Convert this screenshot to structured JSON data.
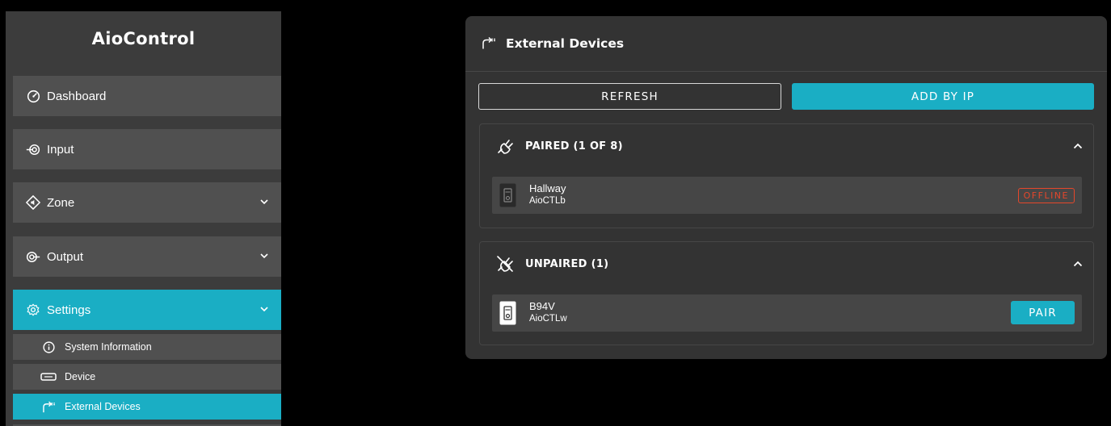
{
  "app": {
    "brand": "AioControl"
  },
  "sidebar": {
    "items": [
      {
        "label": "Dashboard",
        "icon": "gauge-icon",
        "has_chevron": false,
        "active": false
      },
      {
        "label": "Input",
        "icon": "input-icon",
        "has_chevron": false,
        "active": false
      },
      {
        "label": "Zone",
        "icon": "speaker-icon",
        "has_chevron": true,
        "active": false
      },
      {
        "label": "Output",
        "icon": "output-icon",
        "has_chevron": true,
        "active": false
      },
      {
        "label": "Settings",
        "icon": "gear-icon",
        "has_chevron": true,
        "active": true
      }
    ],
    "sub_items": [
      {
        "label": "System Information",
        "icon": "info-icon",
        "active": false
      },
      {
        "label": "Device",
        "icon": "device-icon",
        "active": false
      },
      {
        "label": "External Devices",
        "icon": "external-devices-icon",
        "active": true
      }
    ]
  },
  "panel": {
    "title": "External Devices",
    "icon": "external-devices-icon",
    "refresh_label": "REFRESH",
    "add_by_ip_label": "ADD BY IP",
    "paired": {
      "title": "PAIRED (1 OF 8)",
      "icon": "plug-icon",
      "devices": [
        {
          "name": "Hallway",
          "model": "AioCTLb",
          "status": "OFFLINE",
          "icon": "keypad-dark-icon"
        }
      ]
    },
    "unpaired": {
      "title": "UNPAIRED (1)",
      "icon": "plug-disconnected-icon",
      "devices": [
        {
          "name": "B94V",
          "model": "AioCTLw",
          "action": "PAIR",
          "icon": "keypad-white-icon"
        }
      ]
    }
  },
  "colors": {
    "accent": "#1aaec4",
    "offline": "#e5472b",
    "sidebar_bg": "#3c3c3c",
    "nav_item_bg": "#505050",
    "panel_bg": "#333333",
    "row_bg": "#464646"
  }
}
